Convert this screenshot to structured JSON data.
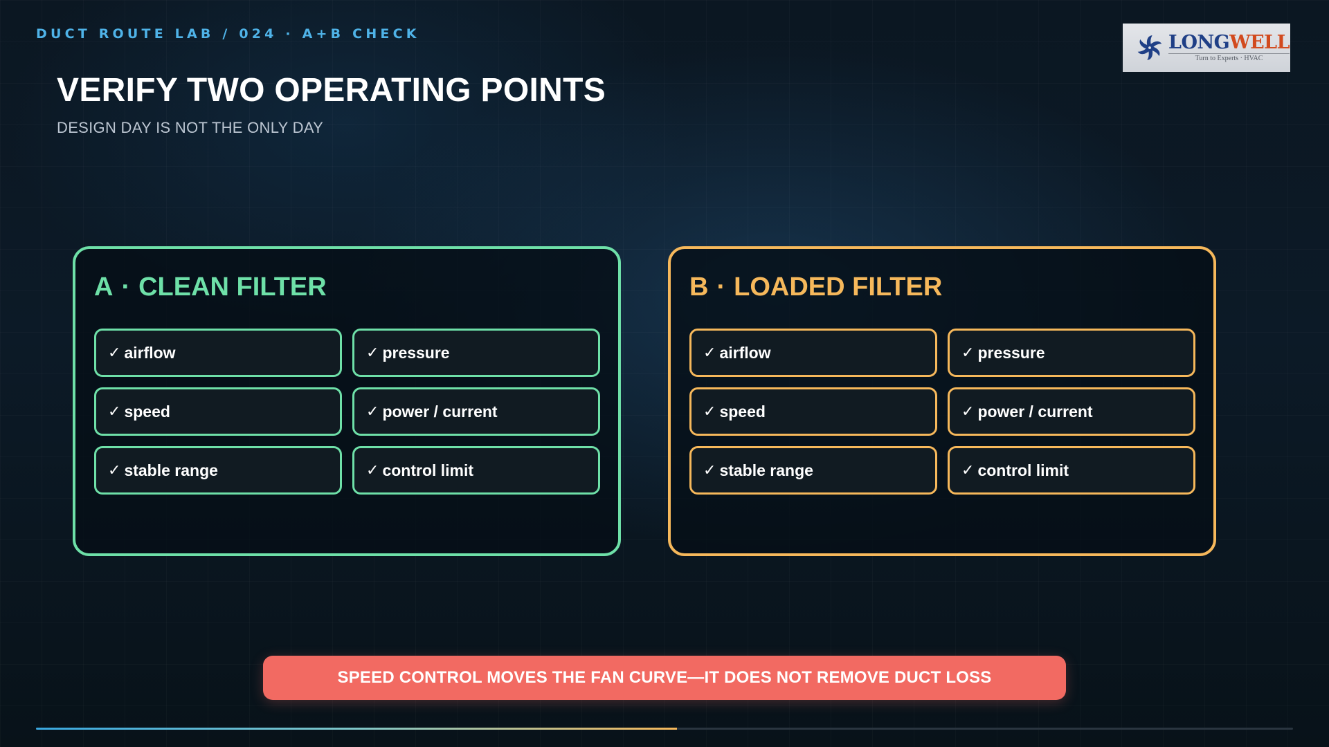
{
  "header": {
    "kicker": "DUCT ROUTE LAB / 024 · A+B CHECK",
    "title": "VERIFY TWO OPERATING POINTS",
    "subtitle": "DESIGN DAY IS NOT THE ONLY DAY"
  },
  "logo": {
    "icon": "fan-icon",
    "name_part1": "LONG",
    "name_part2": "WELL",
    "tagline": "Turn to Experts · HVAC"
  },
  "check_glyph": "✓",
  "cards": [
    {
      "letter": "A",
      "separator": "·",
      "label": "CLEAN FILTER",
      "color": "#6ee0a8",
      "items": [
        "airflow",
        "pressure",
        "speed",
        "power / current",
        "stable range",
        "control limit"
      ]
    },
    {
      "letter": "B",
      "separator": "·",
      "label": "LOADED FILTER",
      "color": "#f6b85b",
      "items": [
        "airflow",
        "pressure",
        "speed",
        "power / current",
        "stable range",
        "control limit"
      ]
    }
  ],
  "banner": {
    "text": "SPEED CONTROL MOVES THE FAN CURVE—IT DOES NOT REMOVE DUCT LOSS",
    "color": "#f26a62"
  },
  "progress": {
    "fraction": 0.51
  }
}
